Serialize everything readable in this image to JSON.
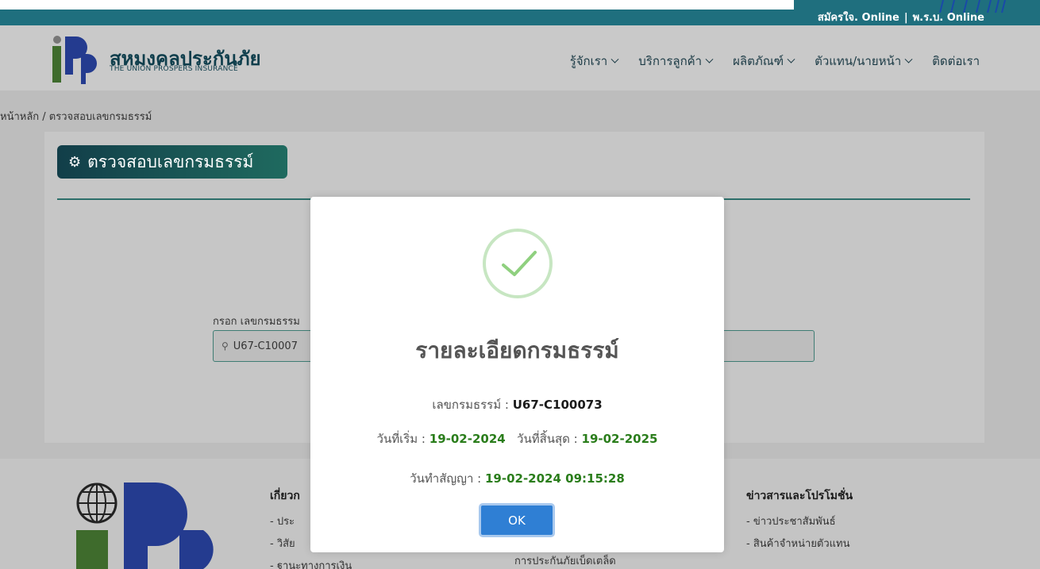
{
  "topbar": {
    "links": [
      "สมัครใจ. Online",
      "พ.ร.บ. Online"
    ],
    "separator": "|"
  },
  "brand": {
    "name": "สหมงคลประกันภัย",
    "subtitle": "THE UNION PROSPERS INSURANCE"
  },
  "nav": [
    {
      "label": "รู้จักเรา",
      "has_dropdown": true
    },
    {
      "label": "บริการลูกค้า",
      "has_dropdown": true
    },
    {
      "label": "ผลิตภัณฑ์",
      "has_dropdown": true
    },
    {
      "label": "ตัวแทน/นายหน้า",
      "has_dropdown": true
    },
    {
      "label": "ติดต่อเรา",
      "has_dropdown": false
    }
  ],
  "breadcrumb": "หน้าหลัก / ตรวจสอบเลขกรมธรรม์",
  "page_title": "ตรวจสอบเลขกรมธรรม์",
  "form": {
    "label": "กรอก เลขกรมธรรม",
    "value": "U67-C10007"
  },
  "footer": {
    "col1": {
      "heading": "เกี่ยวก",
      "items": [
        "- ประ",
        "- วิสัย",
        "- ฐานะทางการเงิน"
      ]
    },
    "col2": {
      "heading": "ข่าวสารและโปรโมชั่น",
      "items": [
        "- ข่าวประชาสัมพันธ์",
        "- สินค้าจำหน่ายตัวแทน"
      ]
    },
    "col3": {
      "items": [
        "การประกันภัยเบ็ดเตล็ด"
      ]
    }
  },
  "modal": {
    "title": "รายละเอียดกรมธรรม์",
    "policy_label": "เลขกรมธรรม์ :",
    "policy_value": "U67-C100073",
    "start_label": "วันที่เริ่ม :",
    "start_value": "19-02-2024",
    "end_label": "วันที่สิ้นสุด :",
    "end_value": "19-02-2025",
    "contract_label": "วันทำสัญญา :",
    "contract_value": "19-02-2024 09:15:28",
    "ok_label": "OK"
  },
  "colors": {
    "accent": "#1f6f7e",
    "success": "#2a7d1b",
    "button": "#2f7fd4"
  }
}
